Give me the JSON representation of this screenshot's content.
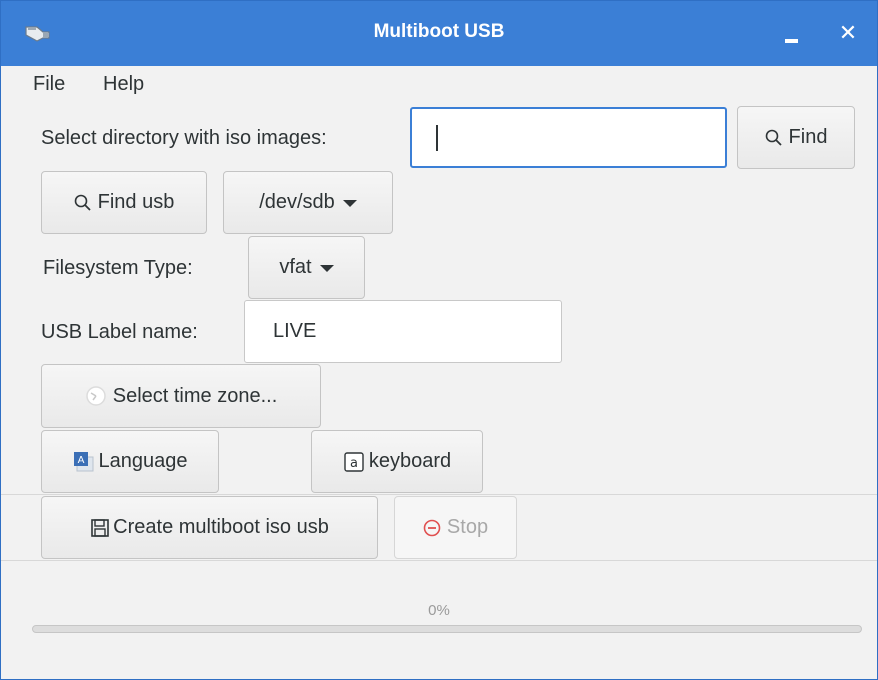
{
  "window": {
    "title": "Multiboot USB",
    "minimize_label": "",
    "close_label": "✕"
  },
  "menu": {
    "items": [
      "File",
      "Help"
    ]
  },
  "iso": {
    "label": "Select directory with iso images:",
    "input_value": "",
    "find_label": "Find"
  },
  "usb": {
    "find_usb_label": "Find usb",
    "device_selected": "/dev/sdb"
  },
  "filesystem": {
    "label": "Filesystem Type:",
    "selected": "vfat"
  },
  "usb_label": {
    "label": "USB Label name:",
    "value": "LIVE"
  },
  "timezone": {
    "button_label": "Select time zone..."
  },
  "language": {
    "button_label": "Language"
  },
  "keyboard": {
    "button_label": "keyboard"
  },
  "actions": {
    "create_label": "Create multiboot iso usb",
    "stop_label": "Stop"
  },
  "progress": {
    "text": "0%",
    "value": 0
  },
  "colors": {
    "accent": "#3b7fd6",
    "stop_icon": "#e05050"
  },
  "icons": {
    "app": "usb-stick-icon",
    "find": "search-icon",
    "timezone": "clock-icon",
    "language": "language-icon",
    "keyboard": "keyboard-icon",
    "create": "save-icon",
    "stop": "stop-icon"
  }
}
